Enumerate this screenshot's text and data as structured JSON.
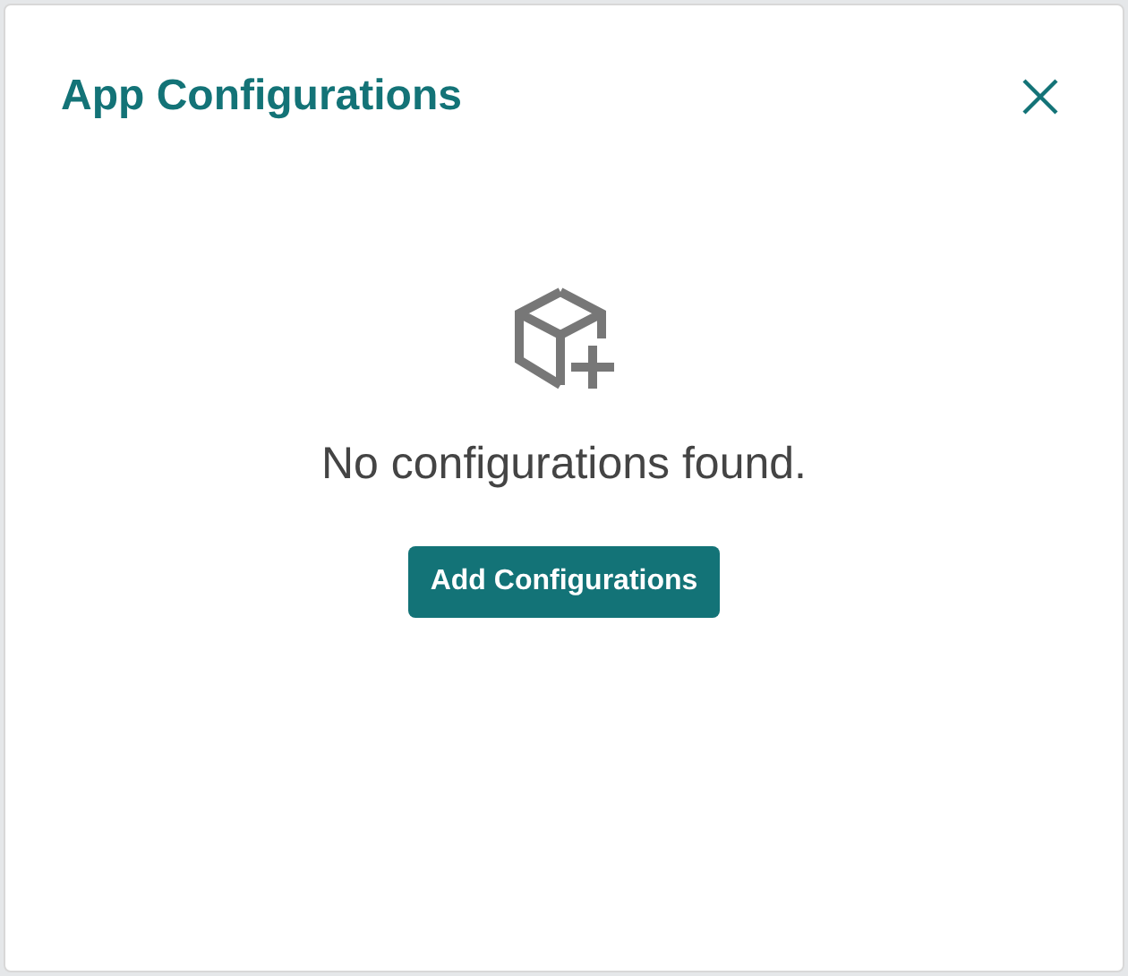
{
  "dialog": {
    "title": "App Configurations",
    "empty_state": {
      "message": "No configurations found.",
      "button": "Add Configurations"
    }
  }
}
